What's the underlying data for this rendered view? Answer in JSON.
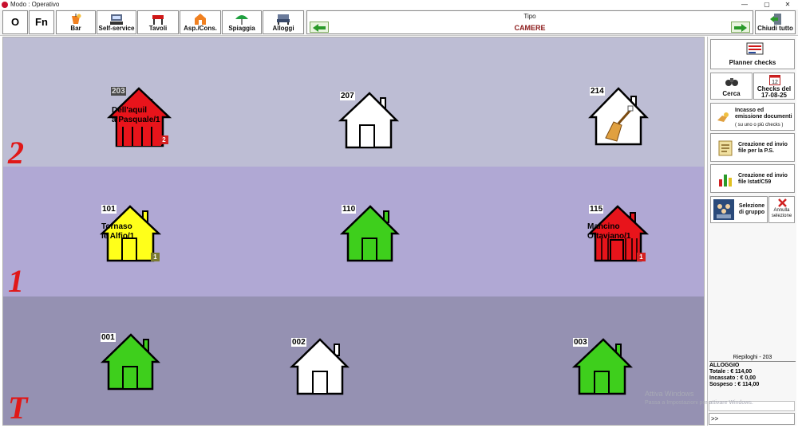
{
  "window": {
    "title": "Modo : Operativo"
  },
  "toolbar": {
    "btn_o": "O",
    "btn_fn": "Fn",
    "buttons": [
      {
        "label": "Bar",
        "icon": "drink-icon"
      },
      {
        "label": "Self-service",
        "icon": "cash-register-icon"
      },
      {
        "label": "Tavoli",
        "icon": "table-icon"
      },
      {
        "label": "Asp./Cons.",
        "icon": "takeaway-icon"
      },
      {
        "label": "Spiaggia",
        "icon": "umbrella-icon"
      },
      {
        "label": "Alloggi",
        "icon": "bed-icon"
      }
    ],
    "tipo_label": "Tipo",
    "tipo_value": "CAMERE",
    "close_all": "Chiudi tutto"
  },
  "floors": [
    {
      "label": "2",
      "rooms": [
        {
          "number": "203",
          "status": "occupied",
          "fill": "#e8141b",
          "guest": "Dell'aquil\na Pasquale/1",
          "occupants": "2",
          "badge_color": "#d42020",
          "selected": true
        },
        {
          "number": "207",
          "status": "free",
          "fill": "#ffffff",
          "guest": "",
          "occupants": ""
        },
        {
          "number": "214",
          "status": "cleaning",
          "fill": "#ffffff",
          "guest": "",
          "occupants": ""
        }
      ]
    },
    {
      "label": "1",
      "rooms": [
        {
          "number": "101",
          "status": "occupied",
          "fill": "#ffff1a",
          "guest": "Tornaso\nle Alfio/1",
          "occupants": "1",
          "badge_color": "#7a7a30"
        },
        {
          "number": "110",
          "status": "available",
          "fill": "#3ecf1c",
          "guest": "",
          "occupants": ""
        },
        {
          "number": "115",
          "status": "occupied",
          "fill": "#e8141b",
          "guest": "Mancino\nOttaviano/1",
          "occupants": "1",
          "badge_color": "#d42020"
        }
      ]
    },
    {
      "label": "T",
      "rooms": [
        {
          "number": "001",
          "status": "available",
          "fill": "#3ecf1c",
          "guest": "",
          "occupants": ""
        },
        {
          "number": "002",
          "status": "free",
          "fill": "#ffffff",
          "guest": "",
          "occupants": ""
        },
        {
          "number": "003",
          "status": "available",
          "fill": "#3ecf1c",
          "guest": "",
          "occupants": ""
        }
      ]
    }
  ],
  "colors": {
    "floor2_bg": "#bdbdd4",
    "floor1_bg": "#b0a8d4",
    "floorT_bg": "#9591b2",
    "floor_label": "#e01818"
  },
  "side_panel": {
    "planner": "Planner checks",
    "cerca": "Cerca",
    "checks_del": "Checks del",
    "checks_date": "17-08-25",
    "calendar_day": "12",
    "incasso": "Incasso ed emissione documenti",
    "incasso_sub": "( su uno o più checks )",
    "ps": "Creazione ed invio file per la P.S.",
    "istat": "Creazione ed invio file Istat/C59",
    "gruppo": "Selezione di gruppo",
    "annulla": "Annulla selezione"
  },
  "riepilogo": {
    "title": "Riepiloghi - 203",
    "category": "ALLOGGIO",
    "totale": "Totale : € 114,00",
    "incassato": "Incassato : € 0,00",
    "sospeso": "Sospeso : € 114,00"
  },
  "command_line": ">>",
  "watermark": {
    "line1": "Attiva Windows",
    "line2": "Passa a Impostazioni per attivare Windows."
  }
}
